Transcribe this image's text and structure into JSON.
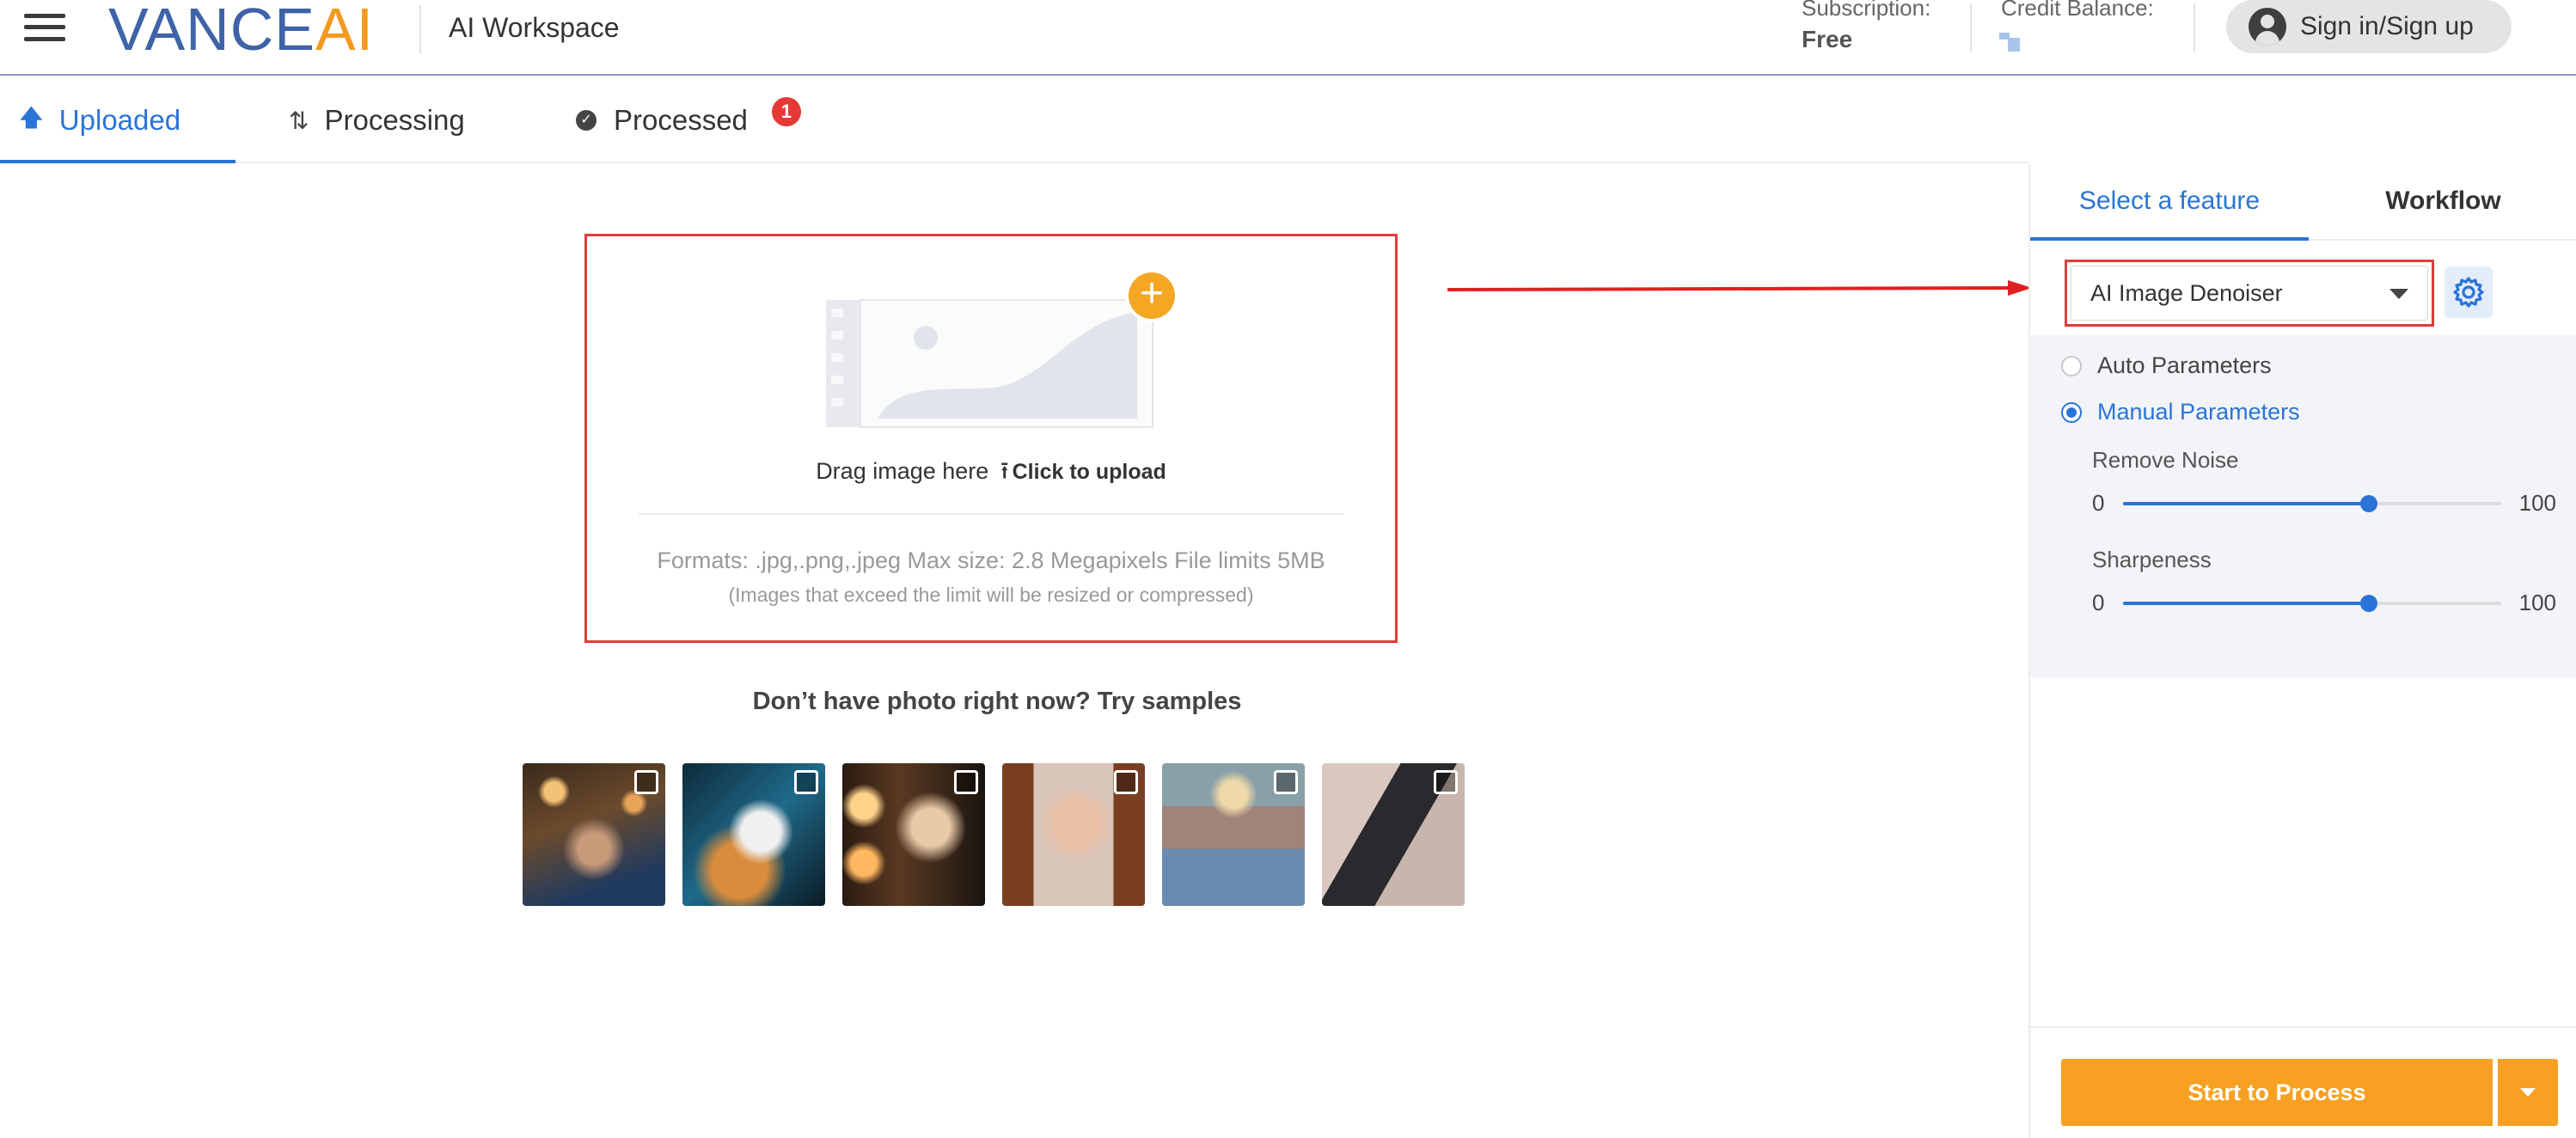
{
  "header": {
    "logo_main": "VANCE",
    "logo_accent": "AI",
    "app_title": "AI Workspace",
    "subscription_label": "Subscription:",
    "subscription_value": "Free",
    "credit_label": "Credit Balance:",
    "signin_label": "Sign in/Sign up"
  },
  "tabs": [
    {
      "label": "Uploaded",
      "icon": "upload-arrow-icon",
      "active": true
    },
    {
      "label": "Processing",
      "icon": "refresh-icon",
      "active": false
    },
    {
      "label": "Processed",
      "icon": "check-circle-icon",
      "active": false,
      "badge": "1"
    }
  ],
  "upload": {
    "drag_text": "Drag image here",
    "click_text": "Click to upload",
    "formats": "Formats: .jpg,.png,.jpeg Max size: 2.8 Megapixels File limits 5MB",
    "note": "(Images that exceed the limit will be resized or compressed)"
  },
  "samples": {
    "title": "Don’t have photo right now? Try samples",
    "items": [
      {
        "name": "sample-woman-bokeh"
      },
      {
        "name": "sample-cat"
      },
      {
        "name": "sample-blonde-woman-lights"
      },
      {
        "name": "sample-woman-portrait"
      },
      {
        "name": "sample-woman-jacket"
      },
      {
        "name": "sample-architecture"
      }
    ]
  },
  "panel": {
    "tab_feature": "Select a feature",
    "tab_workflow": "Workflow",
    "selected_feature": "AI Image Denoiser",
    "auto_label": "Auto Parameters",
    "manual_label": "Manual Parameters",
    "params": [
      {
        "label": "Remove Noise",
        "min": "0",
        "max": "100",
        "value": 65
      },
      {
        "label": "Sharpeness",
        "min": "0",
        "max": "100",
        "value": 65
      }
    ],
    "process_label": "Start to Process"
  },
  "colors": {
    "accent_blue": "#2a74d8",
    "brand_orange": "#f7a021",
    "highlight_red": "#e03c3c"
  }
}
